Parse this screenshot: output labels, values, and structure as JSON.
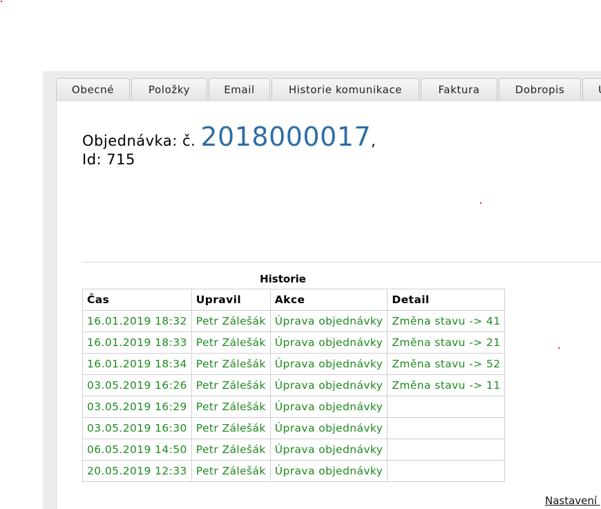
{
  "tabs": [
    "Obecné",
    "Položky",
    "Email",
    "Historie komunikace",
    "Faktura",
    "Dobropis",
    "U"
  ],
  "order": {
    "label": "Objednávka: č.",
    "number": "2018000017",
    "comma": ",",
    "id_text": "Id: 715"
  },
  "history": {
    "caption": "Historie",
    "columns": [
      "Čas",
      "Upravil",
      "Akce",
      "Detail"
    ],
    "rows": [
      [
        "16.01.2019 18:32",
        "Petr Zálešák",
        "Úprava objednávky",
        "Změna stavu -> 41"
      ],
      [
        "16.01.2019 18:33",
        "Petr Zálešák",
        "Úprava objednávky",
        "Změna stavu -> 21"
      ],
      [
        "16.01.2019 18:34",
        "Petr Zálešák",
        "Úprava objednávky",
        "Změna stavu -> 52"
      ],
      [
        "03.05.2019 16:26",
        "Petr Zálešák",
        "Úprava objednávky",
        "Změna stavu -> 11"
      ],
      [
        "03.05.2019 16:29",
        "Petr Zálešák",
        "Úprava objednávky",
        ""
      ],
      [
        "03.05.2019 16:30",
        "Petr Zálešák",
        "Úprava objednávky",
        ""
      ],
      [
        "06.05.2019 14:50",
        "Petr Zálešák",
        "Úprava objednávky",
        ""
      ],
      [
        "20.05.2019 12:33",
        "Petr Zálešák",
        "Úprava objednávky",
        ""
      ]
    ]
  },
  "footer_link": "Nastavení p",
  "colors": {
    "accent": "#2e6da4",
    "history_text": "#1f8a1f"
  }
}
